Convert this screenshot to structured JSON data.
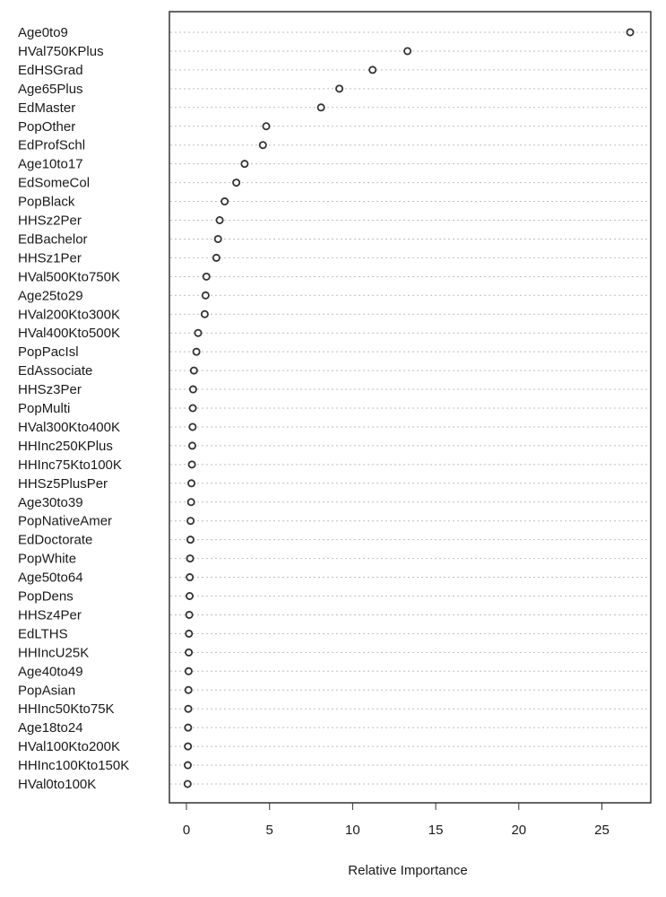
{
  "chart_data": {
    "type": "scatter",
    "title": "",
    "xlabel": "Relative Importance",
    "ylabel": "",
    "xlim": [
      -1,
      27.5
    ],
    "x_ticks": [
      0,
      5,
      10,
      15,
      20,
      25
    ],
    "x_tick_labels": [
      "0",
      "5",
      "10",
      "15",
      "20",
      "25"
    ],
    "grid": "horizontal dotted",
    "legend": "none",
    "point_color": "#333333",
    "grid_color": "#bebebe",
    "categories": [
      "Age0to9",
      "HVal750KPlus",
      "EdHSGrad",
      "Age65Plus",
      "EdMaster",
      "PopOther",
      "EdProfSchl",
      "Age10to17",
      "EdSomeCol",
      "PopBlack",
      "HHSz2Per",
      "EdBachelor",
      "HHSz1Per",
      "HVal500Kto750K",
      "Age25to29",
      "HVal200Kto300K",
      "HVal400Kto500K",
      "PopPacIsl",
      "EdAssociate",
      "HHSz3Per",
      "PopMulti",
      "HVal300Kto400K",
      "HHInc250KPlus",
      "HHInc75Kto100K",
      "HHSz5PlusPer",
      "Age30to39",
      "PopNativeAmer",
      "EdDoctorate",
      "PopWhite",
      "Age50to64",
      "PopDens",
      "HHSz4Per",
      "EdLTHS",
      "HHIncU25K",
      "Age40to49",
      "PopAsian",
      "HHInc50Kto75K",
      "Age18to24",
      "HVal100Kto200K",
      "HHInc100Kto150K",
      "HVal0to100K"
    ],
    "values": [
      26.7,
      13.3,
      11.2,
      9.2,
      8.1,
      4.8,
      4.6,
      3.5,
      3.0,
      2.3,
      2.0,
      1.9,
      1.8,
      1.2,
      1.15,
      1.1,
      0.7,
      0.6,
      0.45,
      0.4,
      0.38,
      0.37,
      0.35,
      0.33,
      0.3,
      0.28,
      0.25,
      0.24,
      0.22,
      0.2,
      0.19,
      0.17,
      0.15,
      0.14,
      0.13,
      0.12,
      0.11,
      0.1,
      0.09,
      0.08,
      0.07
    ]
  }
}
